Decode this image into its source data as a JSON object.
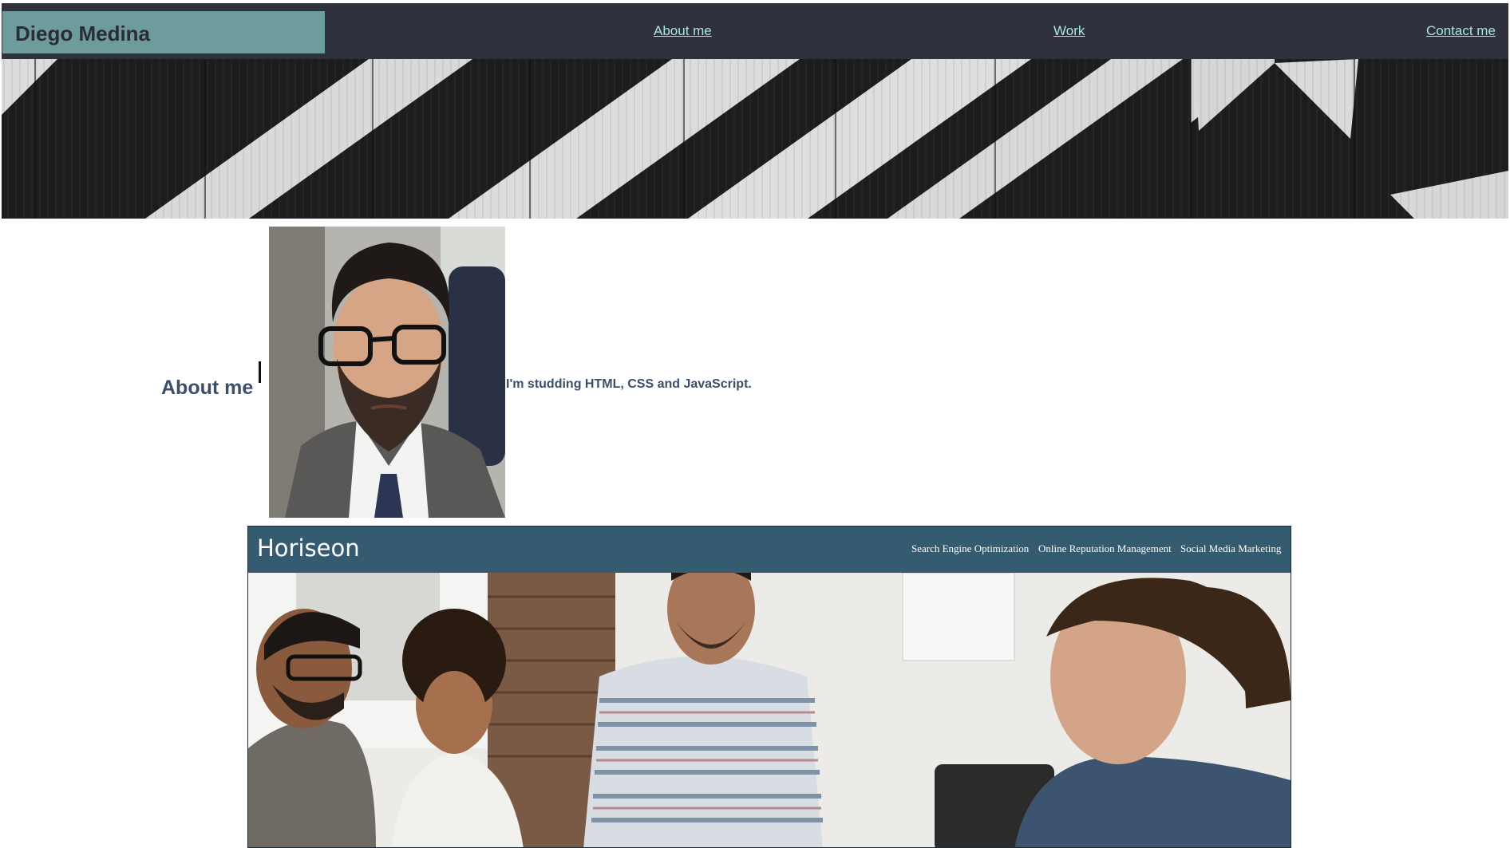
{
  "header": {
    "brand_name": "Diego Medina",
    "nav": [
      {
        "label": "About me"
      },
      {
        "label": "Work"
      },
      {
        "label": "Contact me"
      }
    ]
  },
  "about": {
    "title": "About me",
    "text": "I'm studding HTML, CSS and JavaScript."
  },
  "work": {
    "project_logo": "Horiseon",
    "project_nav": [
      {
        "label": "Search Engine Optimization"
      },
      {
        "label": "Online Reputation Management"
      },
      {
        "label": "Social Media Marketing"
      }
    ]
  },
  "colors": {
    "header_bg": "#2f323c",
    "brand_bg": "#6e9b9b",
    "nav_link": "#a7e6e0",
    "heading_text": "#3c4f6a",
    "project_header_bg": "#355b70"
  }
}
